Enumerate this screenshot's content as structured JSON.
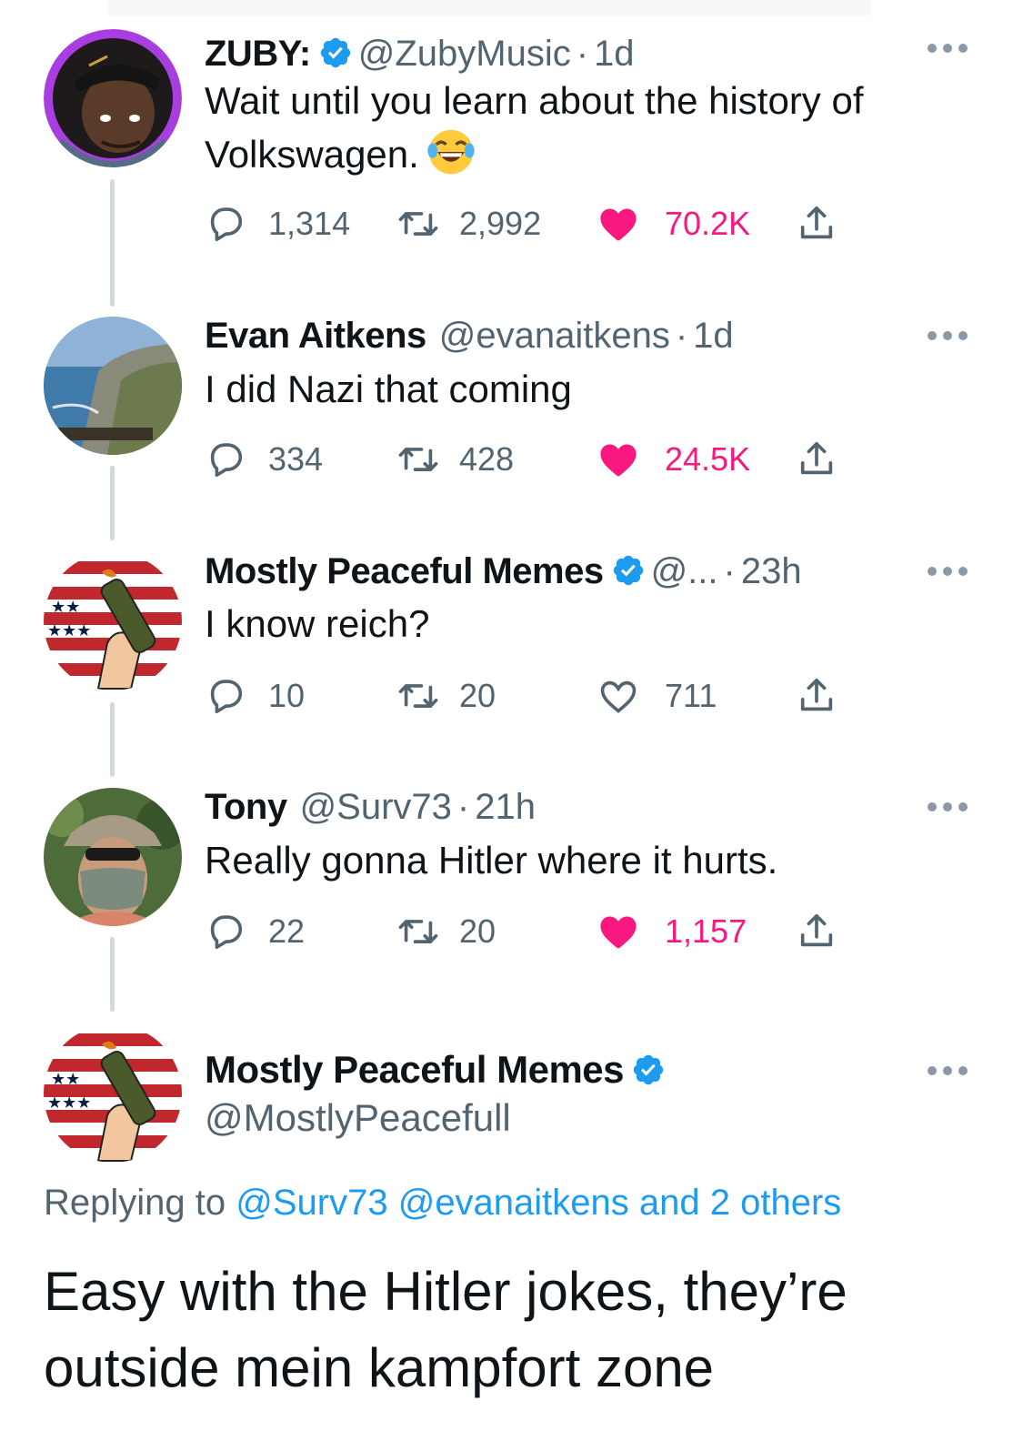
{
  "tweets": [
    {
      "name": "ZUBY:",
      "verified": true,
      "handle": "@ZubyMusic",
      "dot": "·",
      "time": "1d",
      "text_line1": "Wait until you learn about the history of",
      "text_line2": "Volkswagen.",
      "emoji": "face-with-tears-of-joy",
      "replies": "1,314",
      "retweets": "2,992",
      "likes": "70.2K",
      "liked": true
    },
    {
      "name": "Evan Aitkens",
      "verified": false,
      "handle": "@evanaitkens",
      "dot": "·",
      "time": "1d",
      "text_line1": "I did Nazi that coming",
      "replies": "334",
      "retweets": "428",
      "likes": "24.5K",
      "liked": true
    },
    {
      "name": "Mostly Peaceful Memes",
      "verified": true,
      "handle": "@...",
      "dot": "·",
      "time": "23h",
      "text_line1": "I know reich?",
      "replies": "10",
      "retweets": "20",
      "likes": "711",
      "liked": false
    },
    {
      "name": "Tony",
      "verified": false,
      "handle": "@Surv73",
      "dot": "·",
      "time": "21h",
      "text_line1": "Really gonna Hitler where it hurts.",
      "replies": "22",
      "retweets": "20",
      "likes": "1,157",
      "liked": true
    }
  ],
  "main_tweet": {
    "name": "Mostly Peaceful Memes",
    "verified": true,
    "handle": "@MostlyPeacefull",
    "replying_label": "Replying to",
    "replying_links": "@Surv73 @evanaitkens and 2 others",
    "text_line1": "Easy with the Hitler jokes, they’re",
    "text_line2": "outside mein kampfort zone"
  },
  "colors": {
    "like_active": "#f91880",
    "link": "#1d9bf0",
    "muted": "#536471",
    "verified_badge": "#1d9bf0"
  },
  "icons": {
    "reply": "reply-icon",
    "retweet": "retweet-icon",
    "like": "heart-icon",
    "share": "share-icon",
    "more": "more-icon",
    "verified": "verified-badge-icon"
  }
}
